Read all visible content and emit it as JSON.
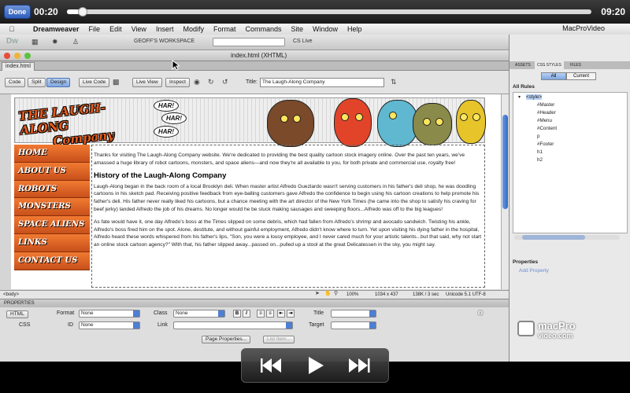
{
  "player": {
    "done_label": "Done",
    "elapsed": "00:20",
    "total": "09:20",
    "progress_fraction": 0.03
  },
  "mac_menu": {
    "app": "Dreamweaver",
    "items": [
      "File",
      "Edit",
      "View",
      "Insert",
      "Modify",
      "Format",
      "Commands",
      "Site",
      "Window",
      "Help"
    ],
    "right_label": "MacProVideo"
  },
  "app_bar": {
    "logo": "Dw",
    "workspace": "GEOFF'S WORKSPACE",
    "cs_live": "CS Live"
  },
  "document": {
    "window_title": "index.html (XHTML)",
    "tab": "index.html",
    "toolbar_buttons": [
      "Code",
      "Split",
      "Design",
      "Live Code",
      "Live View",
      "Inspect"
    ],
    "active_button": "Design",
    "title_label": "Title:",
    "title_value": "The Laugh-Along Company"
  },
  "site": {
    "logo_line1": "THE LAUGH-ALONG",
    "logo_line2": "Company",
    "har": [
      "HAR!",
      "HAR!",
      "HAR!"
    ],
    "nav": [
      "HOME",
      "ABOUT US",
      "ROBOTS",
      "MONSTERS",
      "SPACE ALIENS",
      "LINKS",
      "CONTACT US"
    ],
    "intro": "Thanks for visiting The Laugh-Along Company website. We're dedicated to providing the best quality cartoon stock imagery online. Over the past ten years, we've amassed a huge library of robot cartoons, monsters, and space aliens—and now they're all available to you, for both private and commercial use, royalty free!",
    "heading": "History of the Laugh-Along Company",
    "p1": "Laugh-Along began in the back room of a local Brooklyn deli. When master artist Alfredo Guezlardo wasn't serving customers in his father's deli shop, he was doodling cartoons in his sketch pad. Receiving positive feedback from eye-balling customers gave Alfredo the confidence to begin using his cartoon creations to help promote his father's deli. His father never really liked his cartoons, but a chance meeting with the art director of the New York Times (he came into the shop to satisfy his craving for beef jerky) landed Alfredo the job of his dreams. No longer would he be stuck making sausages and sweeping floors...Alfredo was off to the big leagues!",
    "p2": "As fate would have it, one day Alfredo's boss at the Times slipped on some debris, which had fallen from Alfredo's shrimp and avocado sandwich. Twisting his ankle, Alfredo's boss fired him on the spot. Alone, destitute, and without gainful employment, Alfredo didn't know where to turn. Yet upon visiting his dying father in the hospital, Alfredo heard these words whispered from his father's lips, \"Son, you were a lousy employee, and I never cared much for your artistic talents...but that said, why not start an online stock cartoon agency?\" With that, his father slipped away...passed on...pulled up a stool at the great Delicatessen in the sky, you might say."
  },
  "status_bar": {
    "tag": "<body>",
    "zoom": "100%",
    "size": "1034 x 437",
    "weight": "138K / 3 sec",
    "encoding": "Unicode 5.1 UTF-8"
  },
  "properties": {
    "header": "PROPERTIES",
    "html_label": "HTML",
    "css_label": "CSS",
    "format_label": "Format",
    "format_value": "None",
    "id_label": "ID",
    "id_value": "None",
    "class_label": "Class",
    "class_value": "None",
    "link_label": "Link",
    "title_label": "Title",
    "target_label": "Target",
    "page_props": "Page Properties...",
    "list_item": "List Item..."
  },
  "css_panel": {
    "tabs": [
      "ASSETS",
      "CSS STYLES",
      "FILES"
    ],
    "active_tab": "CSS STYLES",
    "modes": [
      "All",
      "Current"
    ],
    "all_rules": "All Rules",
    "style_root": "<style>",
    "rules": [
      "#Master",
      "#Header",
      "#Menu",
      "#Content",
      "p",
      "#Footer",
      "h1",
      "h2"
    ],
    "props_head": "Properties",
    "add_property": "Add Property"
  },
  "brand": {
    "line1": "macPro",
    "line2": "video.com"
  }
}
